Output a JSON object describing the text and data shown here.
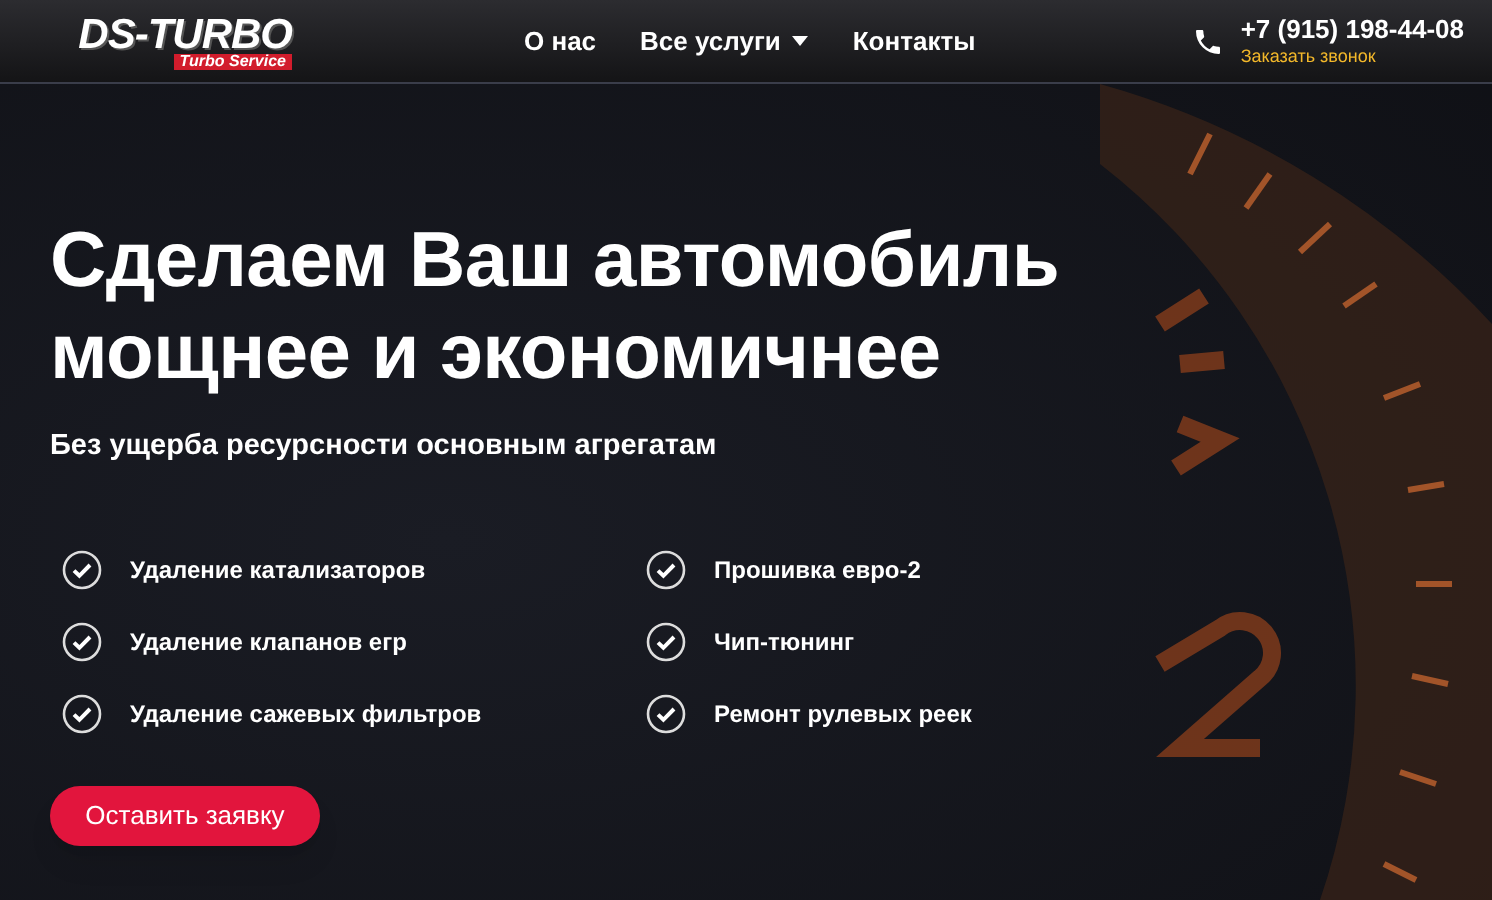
{
  "header": {
    "logo": {
      "title": "DS-TURBO",
      "subtitle": "Turbo Service"
    },
    "nav": [
      {
        "label": "О нас",
        "dropdown": false
      },
      {
        "label": "Все услуги",
        "dropdown": true
      },
      {
        "label": "Контакты",
        "dropdown": false
      }
    ],
    "phone": "+7 (915) 198-44-08",
    "callback_link": "Заказать звонок"
  },
  "hero": {
    "title_lines": [
      "Сделаем Ваш автомобиль",
      "мощнее и экономичнее"
    ],
    "subtitle": "Без ущерба ресурсности основным агрегатам",
    "features": [
      {
        "label": "Удаление катализаторов"
      },
      {
        "label": "Прошивка евро-2"
      },
      {
        "label": "Удаление клапанов егр"
      },
      {
        "label": "Чип-тюнинг"
      },
      {
        "label": "Удаление сажевых фильтров"
      },
      {
        "label": "Ремонт рулевых реек"
      }
    ],
    "button": "Оставить заявку"
  }
}
